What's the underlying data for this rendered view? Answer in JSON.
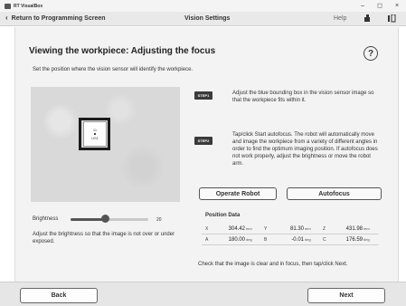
{
  "window": {
    "app_title": "RT VisualBox",
    "min_glyph": "–",
    "max_glyph": "◻",
    "close_glyph": "×"
  },
  "nav": {
    "back_label": "Return to Programming Screen",
    "screen_title": "Vision Settings",
    "help_label": "Help",
    "icon1": "robot-icon",
    "icon2": "menu-icon"
  },
  "page": {
    "title": "Viewing the workpiece: Adjusting the focus",
    "help_icon_glyph": "?",
    "instruction": "Set the position where the vision sensor will identify the workpiece."
  },
  "camera": {
    "workpiece_line1": "11",
    "workpiece_line2": "US1"
  },
  "steps": [
    {
      "badge": "STEP1",
      "text": "Adjust the blue bounding box in the vision sensor image so that the workpiece fits within it."
    },
    {
      "badge": "STEP2",
      "text": "Tap/click Start autofocus. The robot will automatically move and image the workpiece from a variety of different angles in order to find the optimum imaging position. If autofocus does not work properly, adjust the brightness or move the robot arm."
    }
  ],
  "buttons": {
    "operate_robot": "Operate Robot",
    "autofocus": "Autofocus",
    "back": "Back",
    "next": "Next"
  },
  "brightness": {
    "label": "Brightness",
    "value": "20",
    "level_fraction": 0.45,
    "help": "Adjust the brightness so that the image is not over or under exposed."
  },
  "position": {
    "title": "Position Data",
    "rows": [
      [
        {
          "axis": "X",
          "value": "304.42",
          "unit": "mm"
        },
        {
          "axis": "Y",
          "value": "81.30",
          "unit": "mm"
        },
        {
          "axis": "Z",
          "value": "431.98",
          "unit": "mm"
        }
      ],
      [
        {
          "axis": "A",
          "value": "180.00",
          "unit": "deg"
        },
        {
          "axis": "B",
          "value": "-0.01",
          "unit": "deg"
        },
        {
          "axis": "C",
          "value": "176.59",
          "unit": "deg"
        }
      ]
    ]
  },
  "check_text": "Check that the image is clear and in focus, then tap/click Next."
}
